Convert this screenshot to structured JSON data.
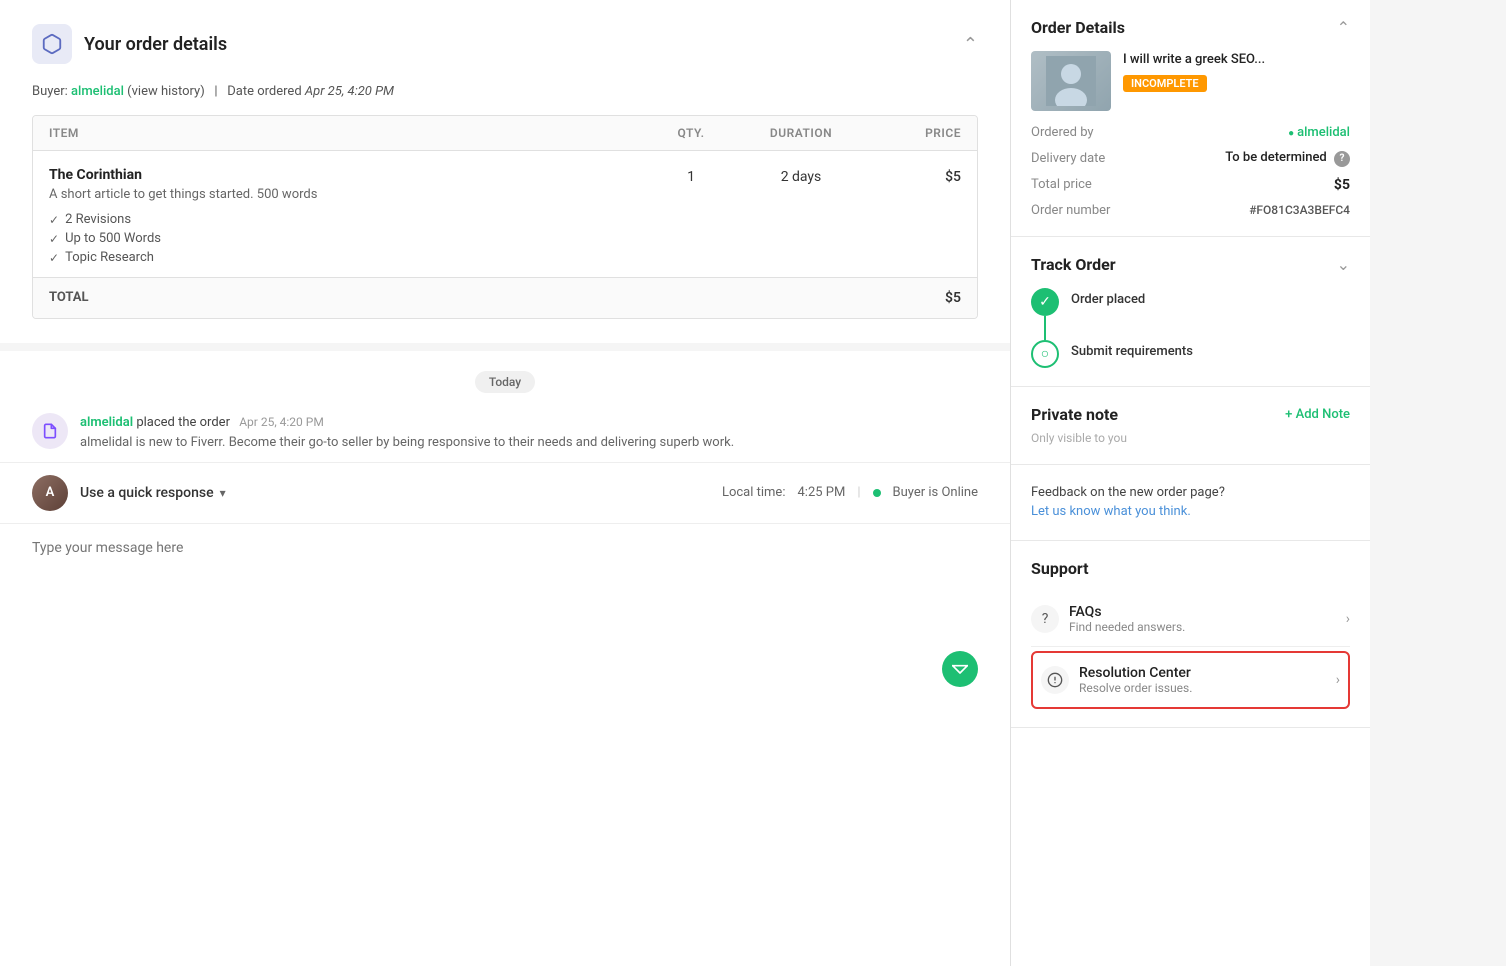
{
  "header": {
    "title": "Your order details",
    "collapse_icon": "^"
  },
  "buyer": {
    "label": "Buyer:",
    "name": "almelidal",
    "view_history": "(view history)",
    "date_label": "Date ordered",
    "date_value": "Apr 25, 4:20 PM"
  },
  "table": {
    "columns": {
      "item": "ITEM",
      "qty": "QTY.",
      "duration": "DURATION",
      "price": "PRICE"
    },
    "rows": [
      {
        "name": "The Corinthian",
        "description": "A short article to get things started. 500 words",
        "features": [
          "2 Revisions",
          "Up to 500 Words",
          "Topic Research"
        ],
        "qty": "1",
        "duration": "2 days",
        "price": "$5"
      }
    ],
    "total_label": "TOTAL",
    "total_price": "$5"
  },
  "chat": {
    "today_label": "Today",
    "event": {
      "user": "almelidal",
      "action": "placed the order",
      "time": "Apr 25, 4:20 PM",
      "sub_text": "almelidal is new to Fiverr. Become their go-to seller by being responsive to their needs and delivering superb work."
    },
    "quick_response": "Use a quick response",
    "local_time_label": "Local time:",
    "local_time": "4:25 PM",
    "buyer_status": "Buyer is Online",
    "message_placeholder": "Type your message here"
  },
  "sidebar": {
    "order_details": {
      "title": "Order Details",
      "gig": {
        "title": "I will write a greek SEO...",
        "status": "incomplete"
      },
      "ordered_by_label": "Ordered by",
      "ordered_by": "almelidal",
      "delivery_date_label": "Delivery date",
      "delivery_date": "To be determined",
      "total_price_label": "Total price",
      "total_price": "$5",
      "order_number_label": "Order number",
      "order_number": "#FO81C3A3BEFC4"
    },
    "track_order": {
      "title": "Track Order",
      "steps": [
        {
          "label": "Order placed",
          "status": "completed"
        },
        {
          "label": "Submit requirements",
          "status": "pending"
        }
      ]
    },
    "private_note": {
      "title": "Private note",
      "add_label": "+ Add Note",
      "sub": "Only visible to you"
    },
    "feedback": {
      "title_text": "Feedback on the new order page?",
      "link_text": "Let us know what you think.",
      "link_url": "#"
    },
    "support": {
      "title": "Support",
      "items": [
        {
          "id": "faqs",
          "icon": "?",
          "title": "FAQs",
          "sub": "Find needed answers."
        },
        {
          "id": "resolution",
          "icon": "⊕",
          "title": "Resolution Center",
          "sub": "Resolve order issues.",
          "highlighted": true
        }
      ]
    }
  }
}
